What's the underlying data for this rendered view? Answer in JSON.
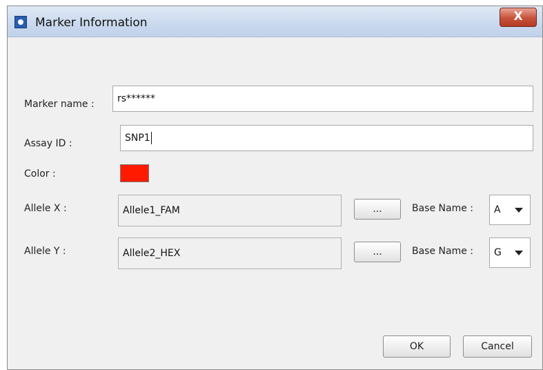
{
  "window": {
    "title": "Marker Information",
    "close_label": "X"
  },
  "form": {
    "marker_name": {
      "label": "Marker name :",
      "value": "rs******"
    },
    "assay_id": {
      "label": "Assay ID :",
      "value": "SNP1"
    },
    "color": {
      "label": "Color :",
      "value": "#ff1a00"
    },
    "allele_x": {
      "label": "Allele X :",
      "value": "Allele1_FAM",
      "browse_label": "...",
      "base_label": "Base Name :",
      "base_value": "A"
    },
    "allele_y": {
      "label": "Allele Y :",
      "value": "Allele2_HEX",
      "browse_label": "...",
      "base_label": "Base Name :",
      "base_value": "G"
    }
  },
  "buttons": {
    "ok": "OK",
    "cancel": "Cancel"
  }
}
